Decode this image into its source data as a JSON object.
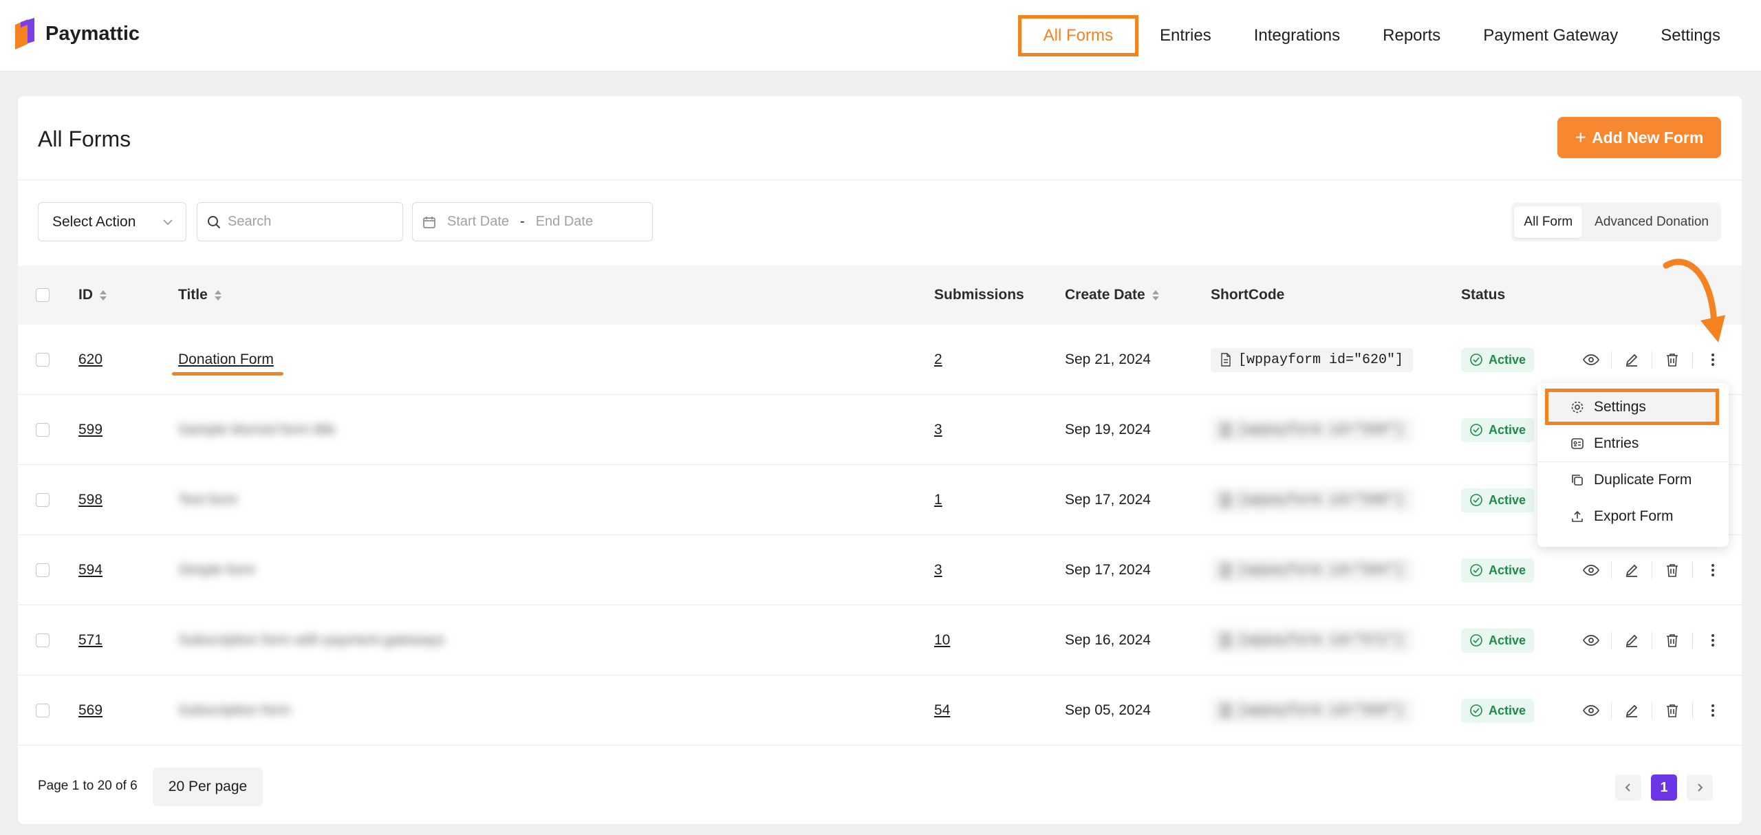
{
  "app": {
    "name": "Paymattic"
  },
  "nav": [
    {
      "label": "All Forms",
      "active": true
    },
    {
      "label": "Entries",
      "active": false
    },
    {
      "label": "Integrations",
      "active": false
    },
    {
      "label": "Reports",
      "active": false
    },
    {
      "label": "Payment Gateway",
      "active": false
    },
    {
      "label": "Settings",
      "active": false
    }
  ],
  "page": {
    "title": "All Forms",
    "add_button": "Add New Form"
  },
  "toolbar": {
    "select_action": "Select Action",
    "search_placeholder": "Search",
    "start_date": "Start Date",
    "date_sep": "-",
    "end_date": "End Date",
    "filters": [
      "All Form",
      "Advanced Donation"
    ]
  },
  "table": {
    "columns": {
      "id": "ID",
      "title": "Title",
      "submissions": "Submissions",
      "date": "Create Date",
      "shortcode": "ShortCode",
      "status": "Status"
    },
    "rows": [
      {
        "id": "620",
        "title": "Donation Form",
        "submissions": "2",
        "date": "Sep 21, 2024",
        "shortcode": "[wppayform id=\"620\"]",
        "status": "Active",
        "blurred": false
      },
      {
        "id": "599",
        "title": "Sample blurred form title",
        "submissions": "3",
        "date": "Sep 19, 2024",
        "shortcode": "[wppayform id=\"599\"]",
        "status": "Active",
        "blurred": true
      },
      {
        "id": "598",
        "title": "Test form",
        "submissions": "1",
        "date": "Sep 17, 2024",
        "shortcode": "[wppayform id=\"598\"]",
        "status": "Active",
        "blurred": true
      },
      {
        "id": "594",
        "title": "Simple form",
        "submissions": "3",
        "date": "Sep 17, 2024",
        "shortcode": "[wppayform id=\"594\"]",
        "status": "Active",
        "blurred": true
      },
      {
        "id": "571",
        "title": "Subscription form with payment gateways",
        "submissions": "10",
        "date": "Sep 16, 2024",
        "shortcode": "[wppayform id=\"571\"]",
        "status": "Active",
        "blurred": true
      },
      {
        "id": "569",
        "title": "Subscription form",
        "submissions": "54",
        "date": "Sep 05, 2024",
        "shortcode": "[wppayform id=\"569\"]",
        "status": "Active",
        "blurred": true
      }
    ]
  },
  "dropdown": [
    "Settings",
    "Entries",
    "Duplicate Form",
    "Export Form"
  ],
  "footer": {
    "page_info": "Page 1 to 20 of 6",
    "per_page": "20 Per page",
    "current_page": "1"
  },
  "colors": {
    "accent": "#f58220",
    "brand_purple": "#6d35e8",
    "active_green": "#1f8a4c"
  }
}
